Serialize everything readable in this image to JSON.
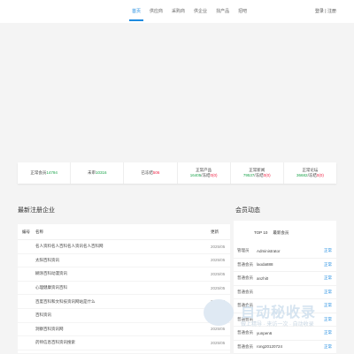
{
  "nav": {
    "items": [
      "首页",
      "供应商",
      "采购商",
      "供企业",
      "找产品",
      "招吧"
    ],
    "login": "登录 | 注册"
  },
  "stats": [
    {
      "line1": "正常会员",
      "v1": "14794",
      "line2": ""
    },
    {
      "line1": "未审",
      "v1": "10316",
      "line2": ""
    },
    {
      "line1": "已冻结",
      "v1": "506",
      "line2": ""
    },
    {
      "line1": "正常产品",
      "v1": "",
      "line2a": "16405",
      "line2b": "/冻结",
      "line2c": "0(0)"
    },
    {
      "line1": "正常新闻",
      "v1": "",
      "line2a": "79537",
      "line2b": "/冻结",
      "line2c": "0(0)"
    },
    {
      "line1": "正常论坛",
      "v1": "",
      "line2a": "36682",
      "line2b": "/冻结",
      "line2c": "0(0)"
    }
  ],
  "sections": {
    "latest": "最新注册企业",
    "members": "会员动态"
  },
  "table": {
    "headers": {
      "num": "编号",
      "name": "名称",
      "date": "更新"
    },
    "rows": [
      {
        "name": "名人资料名人百科名人资讯名人百科网",
        "date": "2025/05"
      },
      {
        "name": "太阳百科资讯",
        "date": "2025/05"
      },
      {
        "name": "糊涂百科动漫资讯",
        "date": "2025/05"
      },
      {
        "name": "心理健康资讯百科",
        "date": "2025/05"
      },
      {
        "name": "百度百科和文科技资讯网站是什么",
        "date": "2025/05"
      },
      {
        "name": "百科资讯",
        "date": "2025/05"
      },
      {
        "name": "洞察百科资讯网",
        "date": "2025/05"
      },
      {
        "name": "药师信息百科资讯搜索",
        "date": "2025/05"
      }
    ]
  },
  "members": {
    "head_a": "TOP 10",
    "head_b": "最新会员",
    "rows": [
      {
        "role": "管理员",
        "name": "Administrator",
        "link": "正常"
      },
      {
        "role": "普通会员",
        "name": "laoda888",
        "link": "正常"
      },
      {
        "role": "普通会员",
        "name": "anzhi0",
        "link": "正常"
      },
      {
        "role": "普通会员",
        "name": "",
        "link": "正常"
      },
      {
        "role": "普通会员",
        "name": "",
        "link": "正常"
      },
      {
        "role": "普通会员",
        "name": "",
        "link": "正常"
      },
      {
        "role": "普通会员",
        "name": "yunpen6",
        "link": "正常"
      },
      {
        "role": "普通会员",
        "name": "rong20120724",
        "link": "正常"
      }
    ]
  },
  "watermark": {
    "text": "自动秘收录",
    "sub": "做上精导 · 来访一次 · 自动收录"
  }
}
